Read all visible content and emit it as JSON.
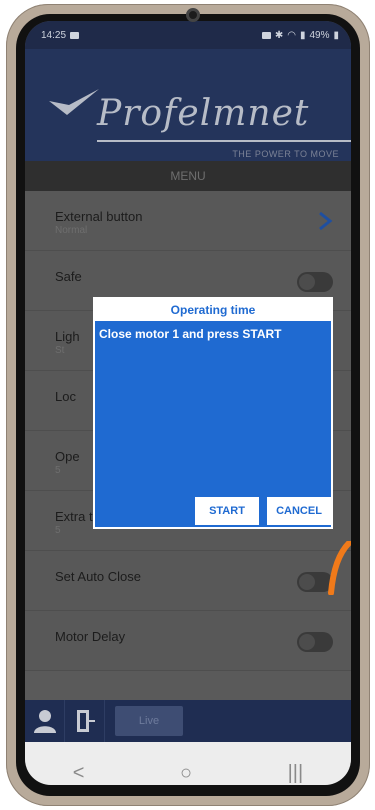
{
  "status": {
    "time": "14:25",
    "battery": "49%"
  },
  "brand": {
    "logo": "Profelmnet",
    "tagline": "THE POWER TO MOVE"
  },
  "menu": {
    "title": "MENU"
  },
  "rows": [
    {
      "label": "External button",
      "sub": "Normal",
      "control": "chevron"
    },
    {
      "label": "Safe",
      "sub": "",
      "control": "toggle"
    },
    {
      "label": "Ligh",
      "sub": "St",
      "control": "chevron"
    },
    {
      "label": "Loc",
      "sub": "",
      "control": "radio"
    },
    {
      "label": "Ope",
      "sub": "5",
      "control": "none"
    },
    {
      "label": "Extra time",
      "sub": "5",
      "control": "none"
    },
    {
      "label": "Set Auto Close",
      "sub": "",
      "control": "toggle"
    },
    {
      "label": "Motor Delay",
      "sub": "",
      "control": "toggle"
    }
  ],
  "appbar": {
    "live_label": "Live"
  },
  "dialog": {
    "title": "Operating time",
    "message": "Close motor 1 and press START",
    "start_label": "START",
    "cancel_label": "CANCEL"
  },
  "nav": {
    "back": "<",
    "home": "○",
    "recents": "|||"
  },
  "colors": {
    "dialog_blue": "#1f6ad1",
    "header_navy": "#24345b",
    "accent_orange": "#f07a1a"
  },
  "icons": {
    "user": "user-icon",
    "exit": "exit-door-icon",
    "chevron": "chevron-right-icon"
  }
}
